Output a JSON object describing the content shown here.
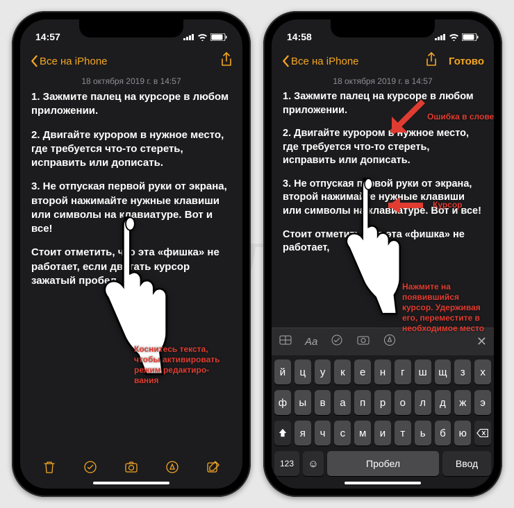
{
  "watermark": "Яблык",
  "left": {
    "time": "14:57",
    "back": "Все на iPhone",
    "date": "18 октября 2019 г. в 14:57",
    "p1": "1. Зажмите палец на курсоре в любом приложении.",
    "p2": "2. Двигайте курором в нужное место, где требуется что-то стереть, исправить или дописать.",
    "p3": "3. Не отпуская первой руки от экрана, второй нажимайте нужные клавиши или символы на клавиатуре. Вот и все!",
    "p4": "Стоит отметить, что эта «фишка» не работает, если двигать курсор зажатый пробел.",
    "annotation": "Коснитесь текста,\nчтобы активировать\nрежим редактиро-\nвания"
  },
  "right": {
    "time": "14:58",
    "back": "Все на iPhone",
    "done": "Готово",
    "date": "18 октября 2019 г. в 14:57",
    "p1": "1. Зажмите палец на курсоре в любом приложении.",
    "p2": "2. Двигайте курором в нужное место, где требуется что-то стереть, исправить или дописать.",
    "p3": "3. Не отпуская первой руки от экрана, второй нажимайте нужные клавиши или символы на клавиатуре. Вот и все!",
    "p4": "Стоит отметить, что эта «фишка» не работает,",
    "anno_error": "Ошибка в слове",
    "anno_cursor": "Курсор",
    "anno_instruction": "Нажмите на\nпоявившийся\nкурсор. Удерживая\nего, переместите в\nнеобходимое место",
    "keys_r1": [
      "й",
      "ц",
      "у",
      "к",
      "е",
      "н",
      "г",
      "ш",
      "щ",
      "з",
      "х"
    ],
    "keys_r2": [
      "ф",
      "ы",
      "в",
      "а",
      "п",
      "р",
      "о",
      "л",
      "д",
      "ж",
      "э"
    ],
    "keys_r3": [
      "я",
      "ч",
      "с",
      "м",
      "и",
      "т",
      "ь",
      "б",
      "ю"
    ],
    "key_123": "123",
    "key_space": "Пробел",
    "key_return": "Ввод"
  }
}
